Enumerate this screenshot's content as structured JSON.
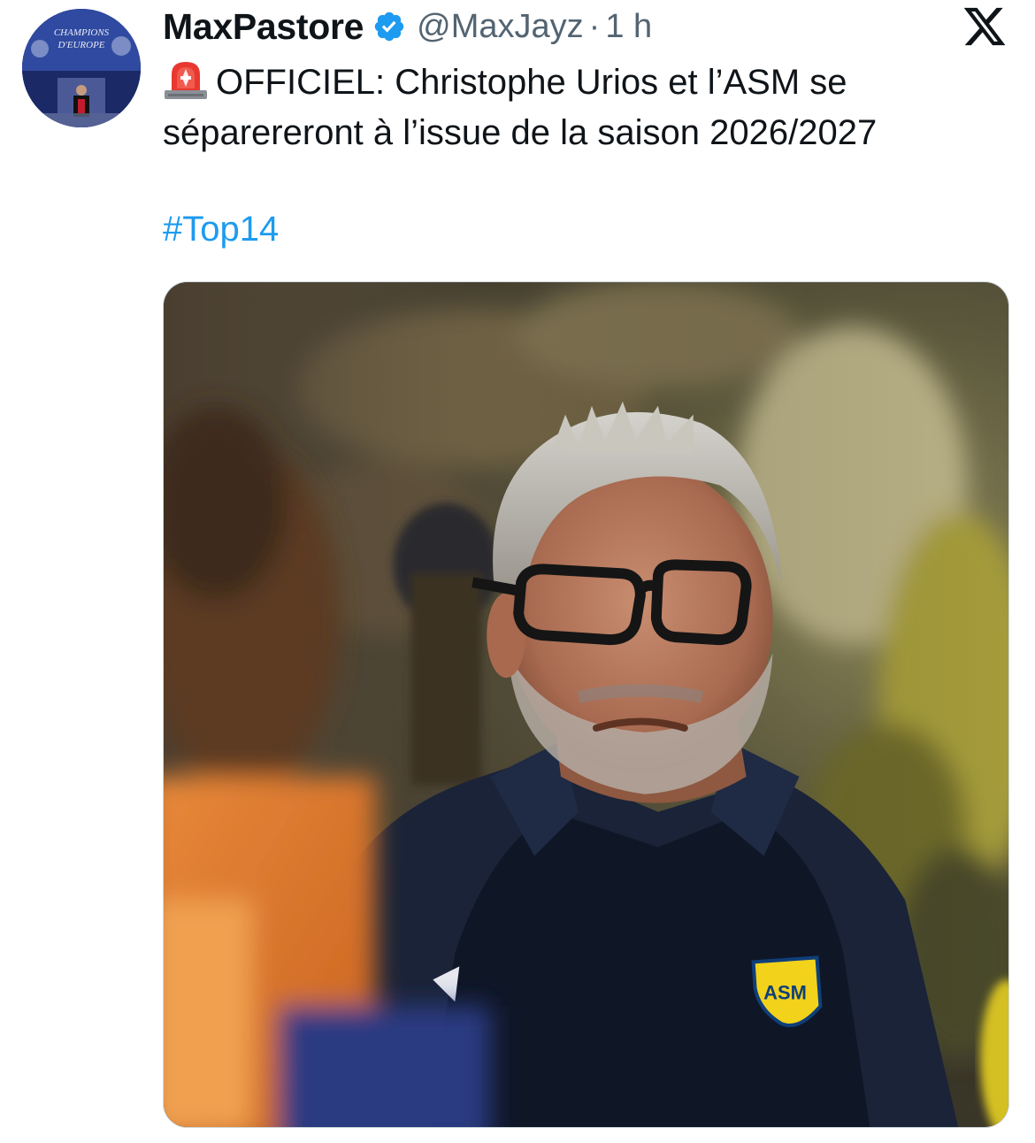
{
  "author": {
    "display_name": "MaxPastore",
    "handle": "@MaxJayz",
    "separator": "·",
    "time": "1 h",
    "avatar_text": [
      "CHAMPIONS",
      "D'EUROPE"
    ],
    "verified_color": "#1d9bf0"
  },
  "tweet": {
    "emoji": "siren-icon",
    "text": "OFFICIEL: Christophe Urios et l’ASM se séparereront à l’issue de la saison 2026/2027",
    "hashtag": "#Top14"
  },
  "media": {
    "badge_text": "ASM"
  },
  "colors": {
    "link": "#1d9bf0",
    "secondary_text": "#536471",
    "primary_text": "#0f1419"
  }
}
